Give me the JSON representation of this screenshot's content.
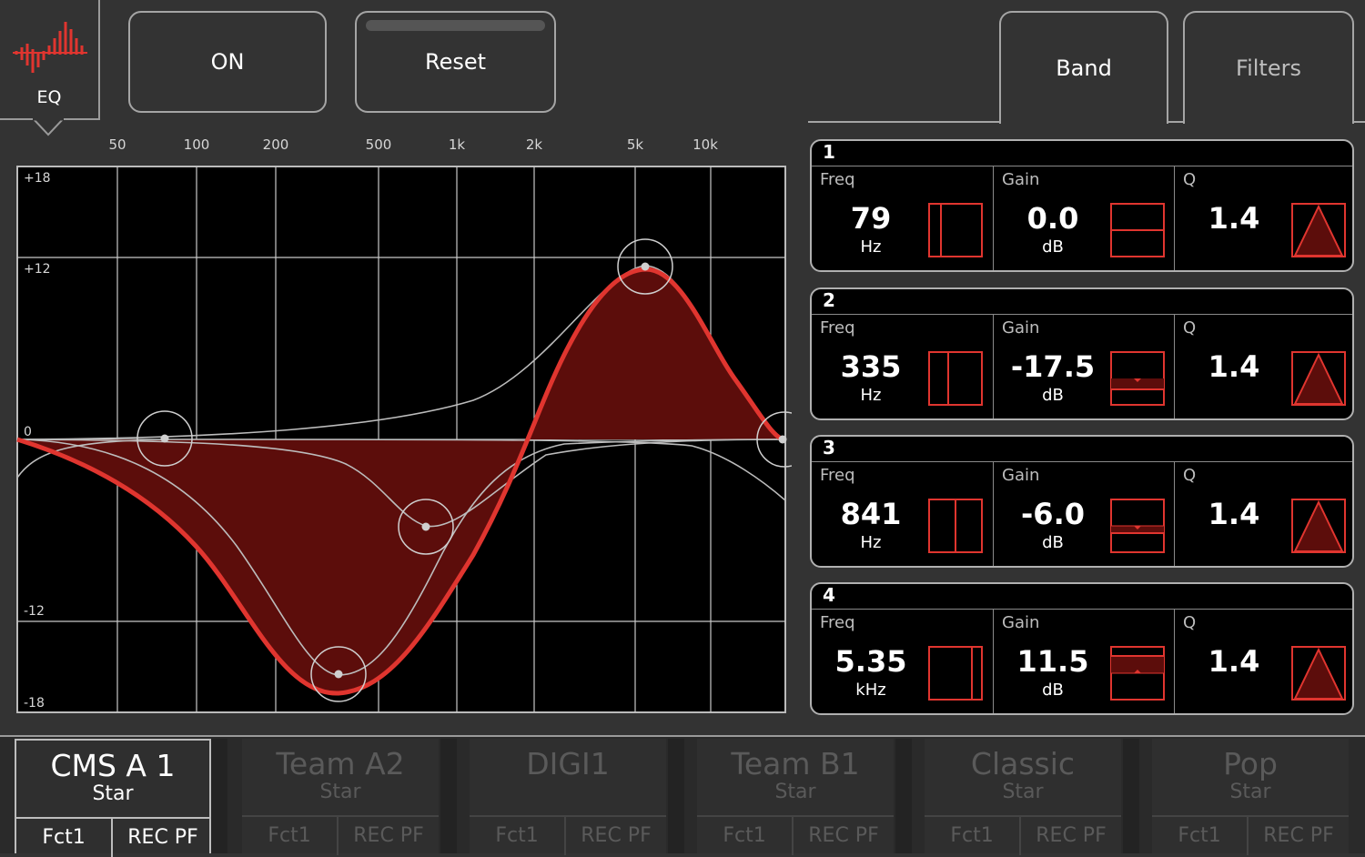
{
  "header": {
    "logo_label": "EQ",
    "on_label": "ON",
    "reset_label": "Reset",
    "tabs": [
      {
        "label": "Band",
        "active": true
      },
      {
        "label": "Filters",
        "active": false
      }
    ]
  },
  "graph": {
    "freq_ticks": [
      "50",
      "100",
      "200",
      "500",
      "1k",
      "2k",
      "5k",
      "10k"
    ],
    "gain_ticks": [
      "+18",
      "+12",
      "0",
      "-12",
      "-18"
    ]
  },
  "bands": [
    {
      "num": "1",
      "freq_label": "Freq",
      "freq_value": "79",
      "freq_unit": "Hz",
      "gain_label": "Gain",
      "gain_value": "0.0",
      "gain_unit": "dB",
      "q_label": "Q",
      "q_value": "1.4"
    },
    {
      "num": "2",
      "freq_label": "Freq",
      "freq_value": "335",
      "freq_unit": "Hz",
      "gain_label": "Gain",
      "gain_value": "-17.5",
      "gain_unit": "dB",
      "q_label": "Q",
      "q_value": "1.4"
    },
    {
      "num": "3",
      "freq_label": "Freq",
      "freq_value": "841",
      "freq_unit": "Hz",
      "gain_label": "Gain",
      "gain_value": "-6.0",
      "gain_unit": "dB",
      "q_label": "Q",
      "q_value": "1.4"
    },
    {
      "num": "4",
      "freq_label": "Freq",
      "freq_value": "5.35",
      "freq_unit": "kHz",
      "gain_label": "Gain",
      "gain_value": "11.5",
      "gain_unit": "dB",
      "q_label": "Q",
      "q_value": "1.4"
    }
  ],
  "presets": [
    {
      "name": "CMS A 1",
      "sub": "Star",
      "fn1": "Fct1",
      "fn2": "REC PF",
      "active": true
    },
    {
      "name": "Team A2",
      "sub": "Star",
      "fn1": "Fct1",
      "fn2": "REC PF",
      "active": false
    },
    {
      "name": "DIGI1",
      "sub": "",
      "fn1": "Fct1",
      "fn2": "REC PF",
      "active": false
    },
    {
      "name": "Team B1",
      "sub": "Star",
      "fn1": "Fct1",
      "fn2": "REC PF",
      "active": false
    },
    {
      "name": "Classic",
      "sub": "Star",
      "fn1": "Fct1",
      "fn2": "REC PF",
      "active": false
    },
    {
      "name": "Pop",
      "sub": "Star",
      "fn1": "Fct1",
      "fn2": "REC PF",
      "active": false
    }
  ],
  "colors": {
    "accent": "#e0352f",
    "fill": "#5c0d0b",
    "background": "#333333"
  }
}
